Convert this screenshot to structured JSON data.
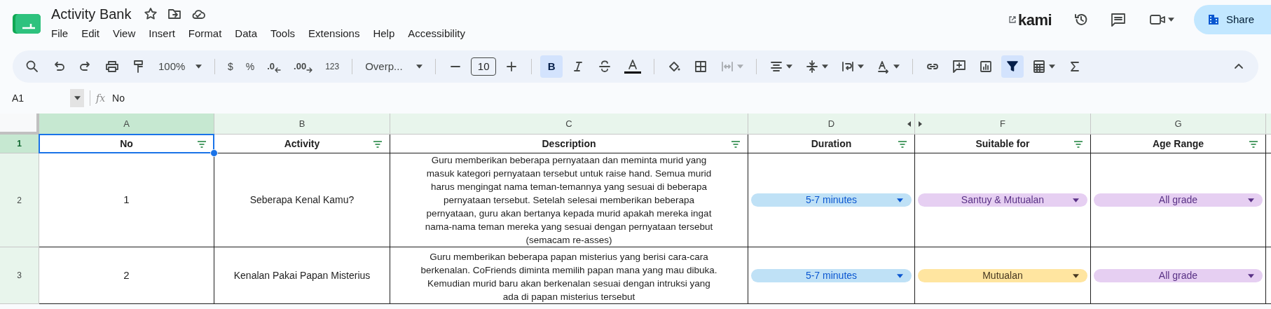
{
  "window": {
    "title": "Activity Bank"
  },
  "menu": [
    "File",
    "Edit",
    "View",
    "Insert",
    "Format",
    "Data",
    "Tools",
    "Extensions",
    "Help",
    "Accessibility"
  ],
  "header_right": {
    "kami": "kami",
    "share": "Share"
  },
  "toolbar": {
    "zoom": "100%",
    "currency": "$",
    "percent": "%",
    "decrease_decimals": ".0",
    "increase_decimals": ".00",
    "number_format": "123",
    "font": "Overp...",
    "font_size": "10",
    "bold": {
      "label": "B",
      "on": true
    },
    "filter_on": true
  },
  "formula_bar": {
    "cell": "A1",
    "fx": "fx",
    "value": "No"
  },
  "columns": [
    {
      "letter": "A",
      "header": "No",
      "selected": true
    },
    {
      "letter": "B",
      "header": "Activity",
      "selected": false
    },
    {
      "letter": "C",
      "header": "Description",
      "selected": false
    },
    {
      "letter": "D",
      "header": "Duration",
      "selected": false
    },
    {
      "letter": "F",
      "header": "Suitable for",
      "selected": false
    },
    {
      "letter": "G",
      "header": "Age Range",
      "selected": false
    }
  ],
  "rows": [
    {
      "number": "2",
      "no": "1",
      "activity": "Seberapa Kenal Kamu?",
      "description": "Guru memberikan beberapa pernyataan dan meminta murid yang masuk kategori pernyataan tersebut untuk raise hand.  Semua murid harus mengingat nama teman-temannya yang sesuai di beberapa pernyataan tersebut. Setelah selesai memberikan beberapa pernyataan, guru akan bertanya kepada murid apakah mereka ingat nama-nama teman mereka yang sesuai dengan pernyataan tersebut (semacam re-asses)",
      "chips": [
        {
          "text": "5-7 minutes",
          "color": "#bfe1f6"
        },
        {
          "text": "Santuy & Mutualan",
          "color": "#e6cff2"
        },
        {
          "text": "All grade",
          "color": "#e6cff2"
        }
      ]
    },
    {
      "number": "3",
      "no": "2",
      "activity": "Kenalan Pakai Papan Misterius",
      "description": "Guru memberikan beberapa papan misterius yang berisi cara-cara berkenalan. CoFriends diminta memilih papan mana yang mau dibuka. Kemudian murid baru akan berkenalan sesuai dengan intruksi yang ada di papan misterius tersebut",
      "chips": [
        {
          "text": "5-7 minutes",
          "color": "#bfe1f6"
        },
        {
          "text": "Mutualan",
          "color": "#ffe5a0"
        },
        {
          "text": "All grade",
          "color": "#e6cff2"
        }
      ]
    }
  ],
  "header_row": {
    "number": "1",
    "selected": true
  }
}
